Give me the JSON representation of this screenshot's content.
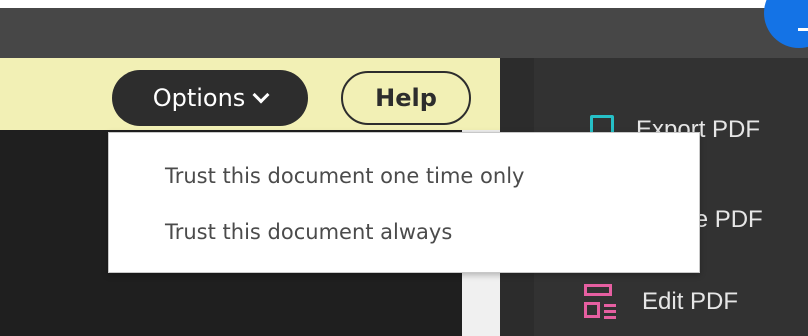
{
  "colors": {
    "topbar": "#474747",
    "accent_blue": "#1473e6",
    "notice_bg": "#f2f0b5",
    "button_dark": "#2d2d2d",
    "panel_bg": "#323232",
    "document_bg": "#1f1f1f"
  },
  "notice": {
    "options_label": "Options",
    "help_label": "Help"
  },
  "options_menu": {
    "items": [
      {
        "label": "Trust this document one time only"
      },
      {
        "label": "Trust this document always"
      }
    ]
  },
  "tools": [
    {
      "label": "Export PDF",
      "icon": "export-pdf-icon"
    },
    {
      "label": "Create PDF",
      "icon": "create-pdf-icon"
    },
    {
      "label": "Edit PDF",
      "icon": "edit-pdf-icon"
    }
  ]
}
